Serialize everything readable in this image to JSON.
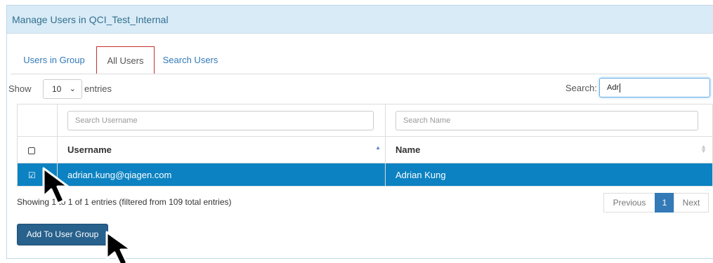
{
  "panel": {
    "title": "Manage Users in QCI_Test_Internal"
  },
  "tabs": [
    {
      "label": "Users in Group"
    },
    {
      "label": "All Users"
    },
    {
      "label": "Search Users"
    }
  ],
  "length": {
    "show_label": "Show",
    "value": "10",
    "entries_label": "entries"
  },
  "search": {
    "label": "Search:",
    "value": "Adr"
  },
  "filters": {
    "username_placeholder": "Search Username",
    "name_placeholder": "Search Name"
  },
  "columns": {
    "username": "Username",
    "name": "Name"
  },
  "rows": [
    {
      "username": "adrian.kung@qiagen.com",
      "name": "Adrian Kung",
      "checked": true
    }
  ],
  "info": "Showing 1 to 1 of 1 entries (filtered from 109 total entries)",
  "pagination": {
    "previous": "Previous",
    "current": "1",
    "next": "Next"
  },
  "actions": {
    "add_label": "Add To User Group"
  },
  "colors": {
    "selected_row": "#0c82c2",
    "heading_bg": "#d9ebf7",
    "primary": "#27618c",
    "active_tab_border": "#c9302c"
  }
}
